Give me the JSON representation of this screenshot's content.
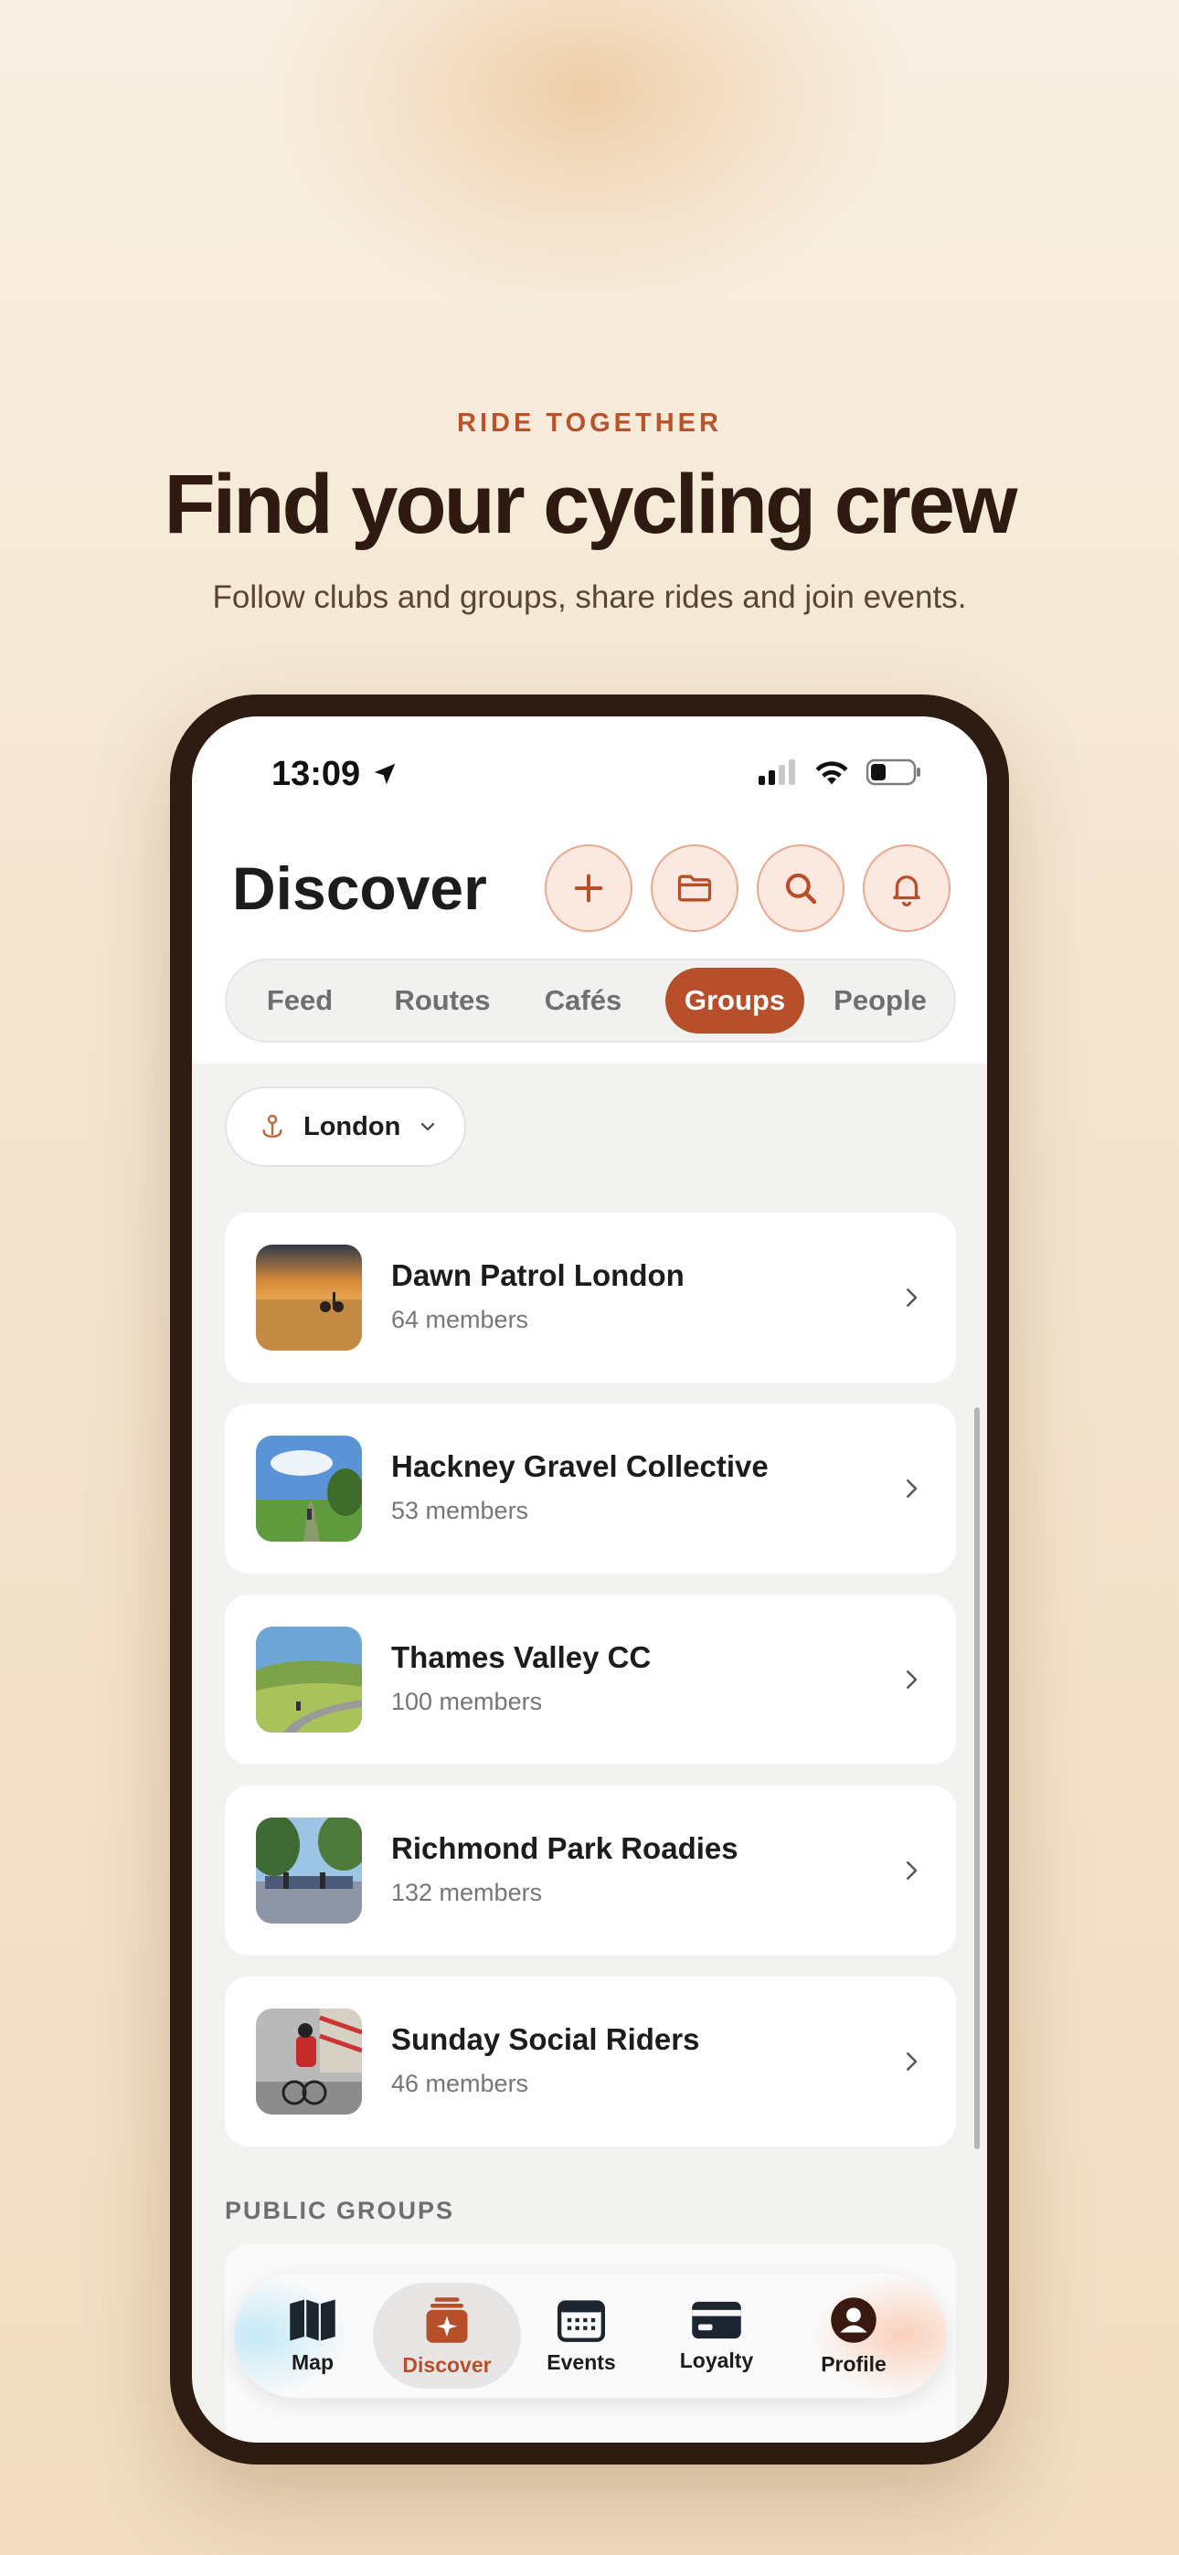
{
  "hero": {
    "eyebrow": "RIDE TOGETHER",
    "headline": "Find your cycling crew",
    "subline": "Follow clubs and groups, share rides and join events."
  },
  "status": {
    "time": "13:09"
  },
  "header": {
    "title": "Discover",
    "buttons": [
      "add-icon",
      "folder-icon",
      "search-icon",
      "bell-icon"
    ]
  },
  "tabs": [
    {
      "label": "Feed",
      "active": false
    },
    {
      "label": "Routes",
      "active": false
    },
    {
      "label": "Cafés",
      "active": false
    },
    {
      "label": "Groups",
      "active": true
    },
    {
      "label": "People",
      "active": false
    }
  ],
  "city": {
    "label": "London"
  },
  "groups": [
    {
      "name": "Dawn Patrol London",
      "members": "64 members"
    },
    {
      "name": "Hackney Gravel Collective",
      "members": "53 members"
    },
    {
      "name": "Thames Valley CC",
      "members": "100 members"
    },
    {
      "name": "Richmond Park Roadies",
      "members": "132 members"
    },
    {
      "name": "Sunday Social Riders",
      "members": "46 members"
    }
  ],
  "section": {
    "public_groups": "PUBLIC GROUPS"
  },
  "tabbar": {
    "items": [
      {
        "label": "Map",
        "icon": "map-icon"
      },
      {
        "label": "Discover",
        "icon": "discover-icon",
        "active": true
      },
      {
        "label": "Events",
        "icon": "calendar-icon"
      },
      {
        "label": "Loyalty",
        "icon": "card-icon"
      },
      {
        "label": "Profile",
        "icon": "profile-icon"
      }
    ]
  },
  "colors": {
    "accent": "#b84f2b",
    "heading": "#2e1a10",
    "background": "#f5e6d2"
  }
}
